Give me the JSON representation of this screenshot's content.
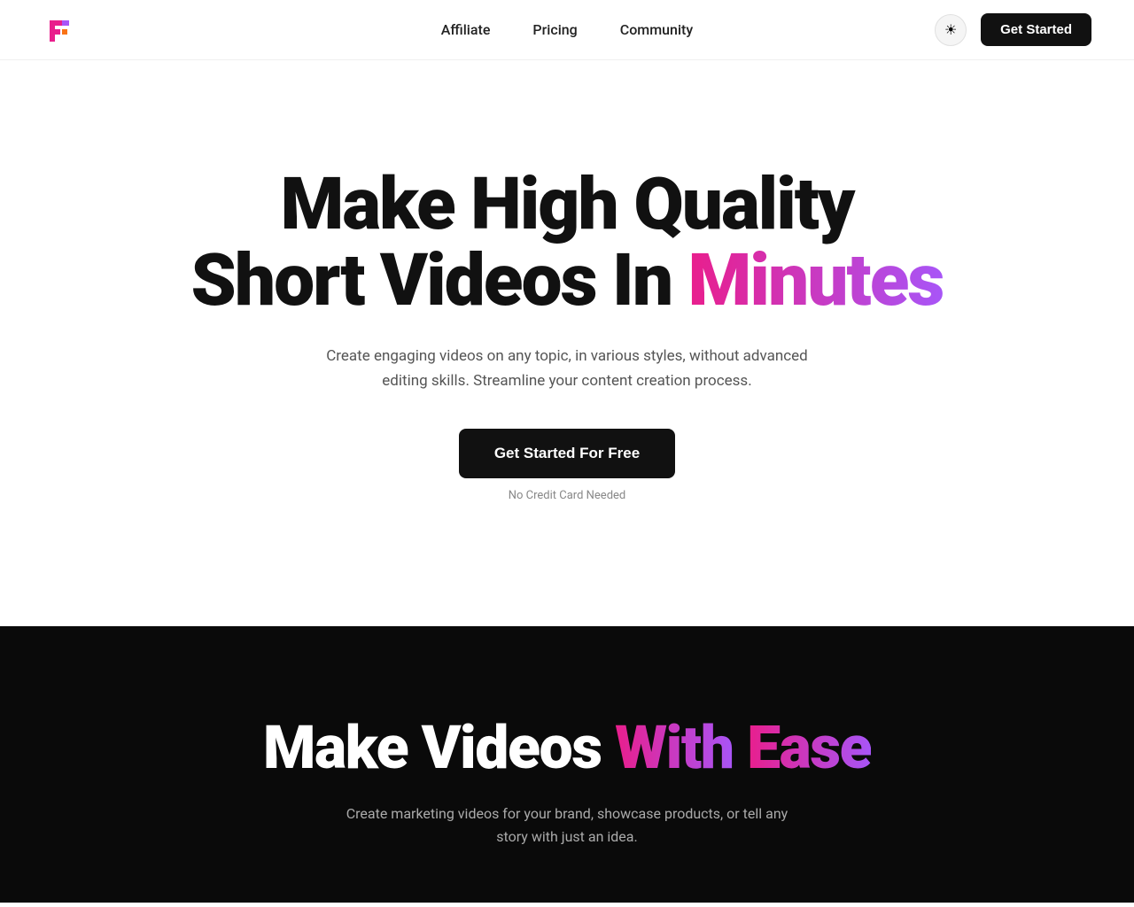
{
  "brand": {
    "logo_alt": "FlexClip Logo"
  },
  "nav": {
    "links": [
      {
        "label": "Affiliate",
        "id": "affiliate"
      },
      {
        "label": "Pricing",
        "id": "pricing"
      },
      {
        "label": "Community",
        "id": "community"
      }
    ],
    "theme_toggle_icon": "☀",
    "get_started_label": "Get Started"
  },
  "hero": {
    "title_line1": "Make High Quality",
    "title_line2_plain": "Short Videos In ",
    "title_line2_gradient": "Minutes",
    "subtitle": "Create engaging videos on any topic, in various styles, without advanced editing skills. Streamline your content creation process.",
    "cta_label": "Get Started For Free",
    "no_credit_card_label": "No Credit Card Needed"
  },
  "dark_section": {
    "title_plain": "Make Videos ",
    "title_gradient1": "With",
    "title_plain2": " ",
    "title_gradient2": "Ease",
    "subtitle": "Create marketing videos for your brand, showcase products, or tell any story with just an idea."
  }
}
